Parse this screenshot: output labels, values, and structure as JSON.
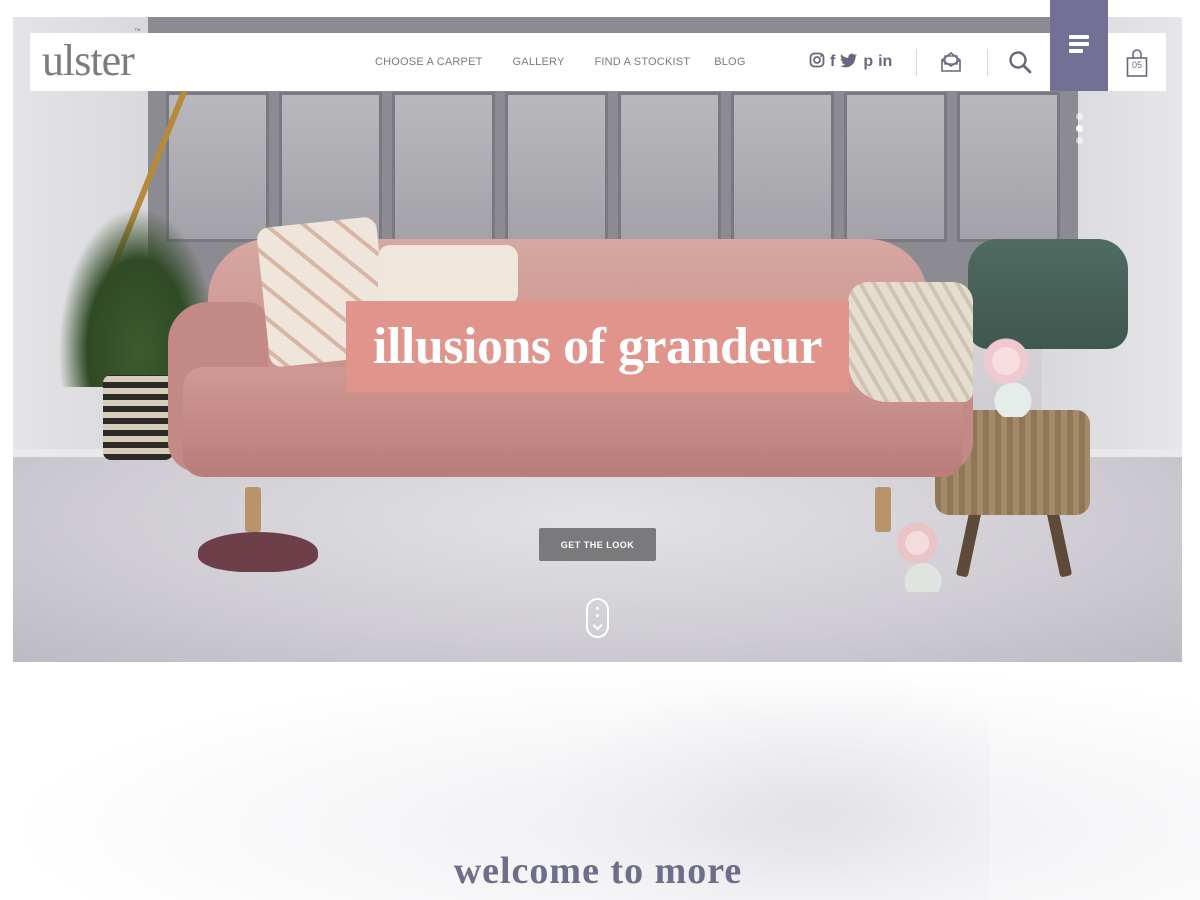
{
  "brand": {
    "logo_text": "ulster",
    "trademark": "™"
  },
  "nav": {
    "items": [
      {
        "label": "CHOOSE A CARPET"
      },
      {
        "label": "GALLERY"
      },
      {
        "label": "FIND A STOCKIST"
      },
      {
        "label": "BLOG"
      }
    ]
  },
  "social": {
    "instagram_icon": "instagram-icon",
    "facebook_icon": "facebook-icon",
    "twitter_icon": "twitter-icon",
    "pinterest_icon": "pinterest-icon",
    "linkedin_icon": "linkedin-icon",
    "facebook_glyph": "f",
    "pinterest_glyph": "p",
    "linkedin_glyph": "in"
  },
  "header": {
    "newsletter_icon": "envelope-icon",
    "search_icon": "search-icon",
    "menu_icon": "hamburger-menu-icon",
    "cart_icon": "shopping-bag-icon",
    "cart_count": "05"
  },
  "hero": {
    "title": "illusions of grandeur",
    "cta_label": "GET THE LOOK",
    "slide_count": 3,
    "active_slide": 2
  },
  "welcome": {
    "title": "welcome to more"
  },
  "colors": {
    "accent_purple": "#727195",
    "hero_title_bg": "#e0948c",
    "cta_bg": "#7a797c",
    "nav_text": "#7a7980",
    "welcome_text": "#6e6d8a"
  }
}
